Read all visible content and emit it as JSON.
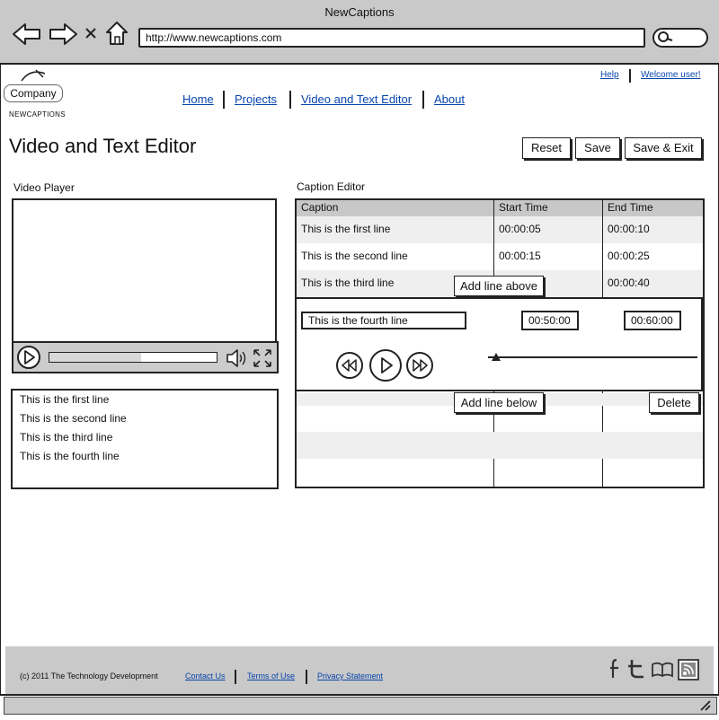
{
  "browser": {
    "window_title": "NewCaptions",
    "url": "http://www.newcaptions.com",
    "back_icon": "arrow-left-icon",
    "forward_icon": "arrow-right-icon",
    "stop_icon": "close-icon",
    "home_icon": "home-icon",
    "search_icon": "search-icon"
  },
  "header": {
    "logo_label": "Company",
    "logo_sub": "NEWCAPTIONS",
    "help": "Help",
    "welcome": "Welcome user!",
    "nav": [
      "Home",
      "Projects",
      "Video and Text Editor",
      "About"
    ]
  },
  "page": {
    "title": "Video and Text Editor",
    "buttons": {
      "reset": "Reset",
      "save": "Save",
      "save_exit": "Save & Exit"
    }
  },
  "video_player": {
    "label": "Video Player",
    "progress": 0.55,
    "transcript": [
      "This is the first line",
      "This is the second line",
      "This is the third line",
      "This is the fourth line"
    ]
  },
  "caption_editor": {
    "label": "Caption Editor",
    "columns": [
      "Caption",
      "Start Time",
      "End Time"
    ],
    "rows": [
      {
        "caption": "This is the first line",
        "start": "00:00:05",
        "end": "00:00:10"
      },
      {
        "caption": "This is the second line",
        "start": "00:00:15",
        "end": "00:00:25"
      },
      {
        "caption": "This is the third line",
        "start": "",
        "end": "00:00:40"
      }
    ],
    "add_above": "Add line above",
    "add_below": "Add line below",
    "delete": "Delete",
    "edit": {
      "caption": "This is the fourth line",
      "start": "00:50:00",
      "end": "00:60:00"
    },
    "slider_value": 0.04
  },
  "footer": {
    "copyright": "(c) 2011 The Technology Development",
    "links": [
      "Contact Us",
      "Terms of Use",
      "Privacy Statement"
    ],
    "social_icons": [
      "facebook-icon",
      "twitter-icon",
      "book-icon",
      "rss-icon"
    ]
  },
  "colors": {
    "chrome": "#c9c9c9",
    "link": "#0645ad",
    "table_header": "#c8c8c8"
  }
}
